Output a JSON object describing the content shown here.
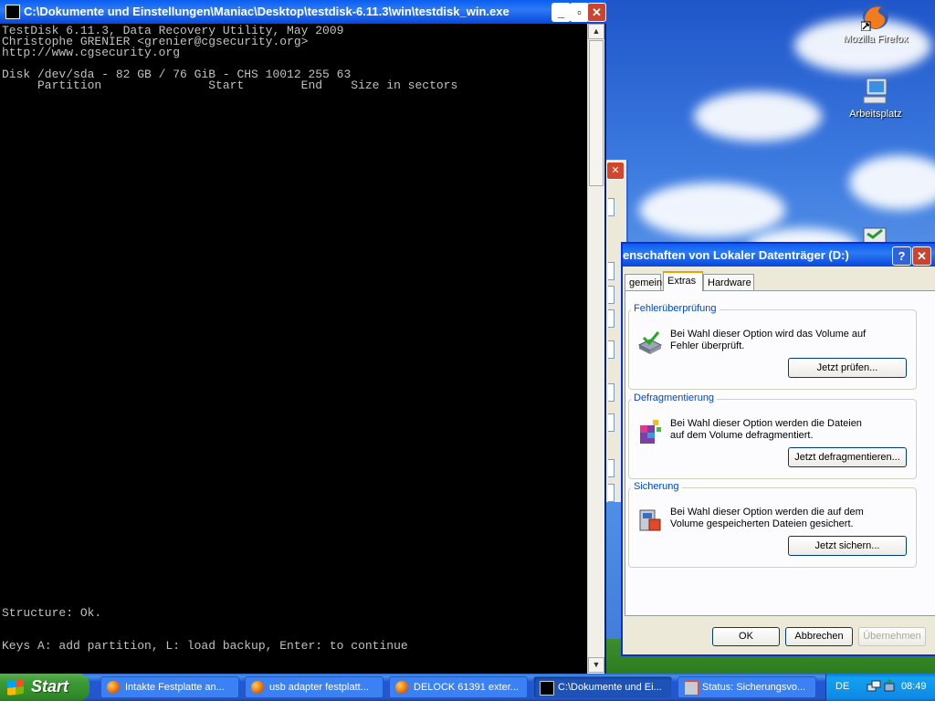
{
  "desktop": {
    "icons": [
      {
        "label": "Mozilla Firefox",
        "icon": "firefox-icon"
      },
      {
        "label": "Arbeitsplatz",
        "icon": "my-computer-icon"
      }
    ]
  },
  "console": {
    "title": "C:\\Dokumente und Einstellungen\\Maniac\\Desktop\\testdisk-6.11.3\\win\\testdisk_win.exe",
    "body": "TestDisk 6.11.3, Data Recovery Utility, May 2009\nChristophe GRENIER <grenier@cgsecurity.org>\nhttp://www.cgsecurity.org\n\nDisk /dev/sda - 82 GB / 76 GiB - CHS 10012 255 63\n     Partition               Start        End    Size in sectors",
    "structure": "Structure: Ok.",
    "keys": "Keys A: add partition, L: load backup, Enter: to continue"
  },
  "props": {
    "title": "enschaften von Lokaler Datenträger (D:)",
    "tabs": [
      "gemein",
      "Extras",
      "Hardware"
    ],
    "active_tab": "Extras",
    "groups": [
      {
        "label": "Fehlerüberprüfung",
        "text": "Bei Wahl dieser Option wird das Volume auf Fehler überprüft.",
        "button": "Jetzt prüfen..."
      },
      {
        "label": "Defragmentierung",
        "text": "Bei Wahl dieser Option werden die Dateien auf dem Volume defragmentiert.",
        "button": "Jetzt defragmentieren..."
      },
      {
        "label": "Sicherung",
        "text": "Bei Wahl dieser Option werden die auf dem Volume gespeicherten Dateien gesichert.",
        "button": "Jetzt sichern..."
      }
    ],
    "ok": "OK",
    "cancel": "Abbrechen",
    "apply": "Übernehmen"
  },
  "taskbar": {
    "start": "Start",
    "tasks": [
      {
        "label": "Intakte Festplatte an...",
        "icon": "firefox-icon"
      },
      {
        "label": "usb adapter festplatt...",
        "icon": "firefox-icon"
      },
      {
        "label": "DELOCK 61391 exter...",
        "icon": "firefox-icon"
      },
      {
        "label": "C:\\Dokumente und Ei...",
        "icon": "console-icon"
      },
      {
        "label": "Status: Sicherungsvo...",
        "icon": "backup-icon"
      }
    ],
    "active_task": 3,
    "lang": "DE",
    "clock": "08:49"
  }
}
